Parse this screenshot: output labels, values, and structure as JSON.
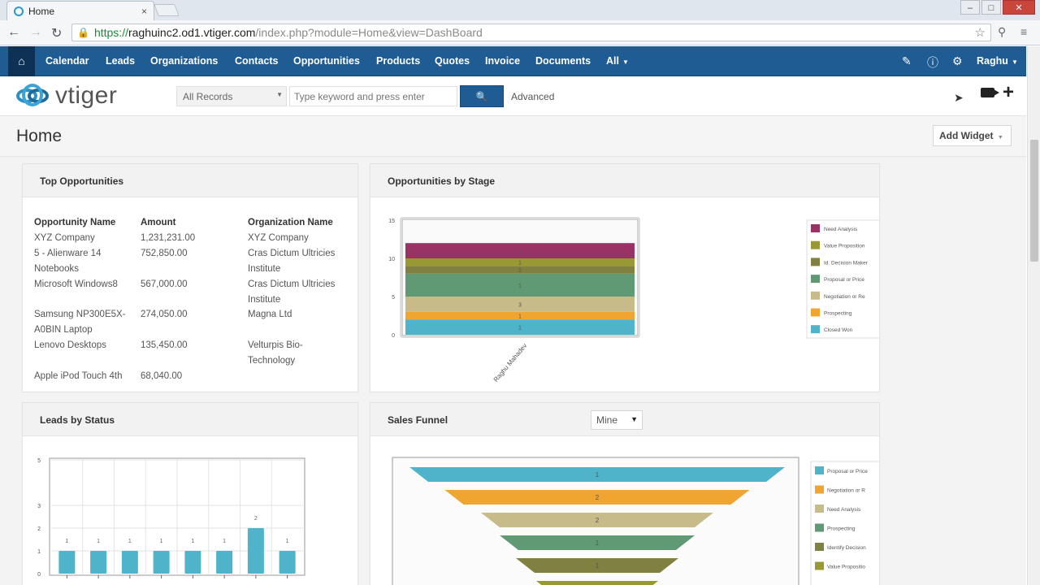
{
  "browser": {
    "tab_title": "Home",
    "tab_close": "×",
    "url_https": "https://",
    "url_host": "raghuinc2.od1.vtiger.com",
    "url_path": "/index.php?module=Home&view=DashBoard"
  },
  "nav": {
    "items": [
      "Calendar",
      "Leads",
      "Organizations",
      "Contacts",
      "Opportunities",
      "Products",
      "Quotes",
      "Invoice",
      "Documents",
      "All"
    ],
    "user": "Raghu"
  },
  "search": {
    "scope": "All Records",
    "placeholder": "Type keyword and press enter",
    "advanced": "Advanced"
  },
  "logo_text": "vtiger",
  "page": {
    "title": "Home",
    "add_widget": "Add Widget"
  },
  "widgets": {
    "top_opps": {
      "title": "Top Opportunities",
      "headers": [
        "Opportunity Name",
        "Amount",
        "Organization Name"
      ],
      "rows": [
        {
          "name": "XYZ Company",
          "amount": "1,231,231.00",
          "org": "XYZ Company"
        },
        {
          "name": "5 - Alienware 14 Notebooks",
          "amount": "752,850.00",
          "org": "Cras Dictum Ultricies Institute"
        },
        {
          "name": "Microsoft Windows8",
          "amount": "567,000.00",
          "org": "Cras Dictum Ultricies Institute"
        },
        {
          "name": "Samsung NP300E5X-A0BIN Laptop",
          "amount": "274,050.00",
          "org": "Magna Ltd"
        },
        {
          "name": "Lenovo Desktops",
          "amount": "135,450.00",
          "org": "Velturpis Bio-Technology"
        },
        {
          "name": "Apple iPod Touch 4th",
          "amount": "68,040.00",
          "org": ""
        }
      ]
    },
    "opp_stage": {
      "title": "Opportunities by Stage",
      "y_ticks": [
        "0",
        "5",
        "10",
        "15"
      ],
      "x_label": "Raghu Mahadev",
      "legend": [
        "Need Analysis",
        "Value Proposition",
        "Id. Decision Maker",
        "Proposal or Price",
        "Negotiation or Re",
        "Prospecting",
        "Closed Won"
      ],
      "segment_labels": [
        "1",
        "1",
        "3",
        "1",
        "1",
        "1",
        "1"
      ]
    },
    "leads_status": {
      "title": "Leads by Status",
      "y_ticks": [
        "0",
        "1",
        "2",
        "3",
        "5"
      ],
      "bar_labels": [
        "1",
        "1",
        "1",
        "1",
        "1",
        "1",
        "2",
        "1"
      ]
    },
    "sales_funnel": {
      "title": "Sales Funnel",
      "filter": "Mine",
      "legend": [
        "Proposal or Price",
        "Negotiation or R",
        "Need Analysis",
        "Prospecting",
        "Identify Decision",
        "Value Propositio"
      ],
      "stage_labels": [
        "1",
        "2",
        "2",
        "1",
        "1",
        "1"
      ]
    }
  },
  "colors": {
    "nav_bg": "#1f5c93",
    "need_analysis": "#993366",
    "value_proposition": "#999933",
    "id_decision": "#808040",
    "proposal": "#5f9a74",
    "negotiation": "#c7bb8a",
    "prospecting": "#f0a530",
    "closed_won": "#4fb3c9",
    "leads_bar": "#4fb3c9"
  },
  "chart_data": [
    {
      "type": "bar",
      "title": "Opportunities by Stage",
      "categories": [
        "Raghu Mahadev"
      ],
      "series": [
        {
          "name": "Closed Won",
          "values": [
            2
          ]
        },
        {
          "name": "Prospecting",
          "values": [
            1
          ]
        },
        {
          "name": "Negotiation or Re",
          "values": [
            2
          ]
        },
        {
          "name": "Proposal or Price",
          "values": [
            3
          ]
        },
        {
          "name": "Id. Decision Maker",
          "values": [
            1
          ]
        },
        {
          "name": "Value Proposition",
          "values": [
            1
          ]
        },
        {
          "name": "Need Analysis",
          "values": [
            2
          ]
        }
      ],
      "stacked": true,
      "ylim": [
        0,
        15
      ]
    },
    {
      "type": "bar",
      "title": "Leads by Status",
      "categories": [
        "",
        "",
        "",
        "",
        "",
        "",
        "",
        ""
      ],
      "values": [
        1,
        1,
        1,
        1,
        1,
        1,
        2,
        1
      ],
      "ylim": [
        0,
        5
      ]
    },
    {
      "type": "bar",
      "title": "Sales Funnel",
      "categories": [
        "Proposal or Price",
        "Negotiation or R",
        "Need Analysis",
        "Prospecting",
        "Identify Decision",
        "Value Propositio"
      ],
      "values": [
        1,
        2,
        2,
        1,
        1,
        1
      ]
    }
  ]
}
